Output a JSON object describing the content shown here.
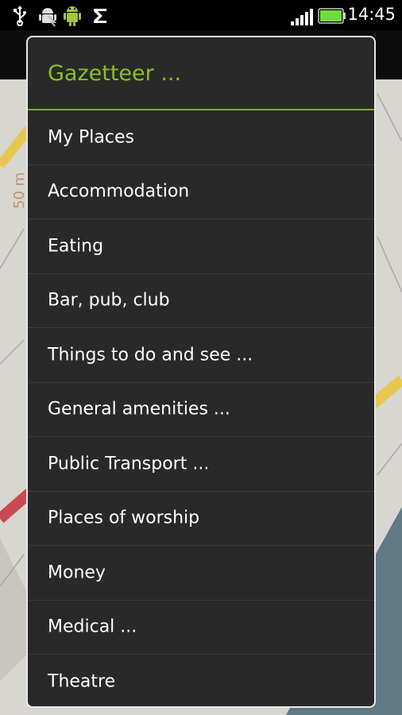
{
  "status_bar": {
    "time": "14:45",
    "icons": [
      "usb-icon",
      "android-debug-icon",
      "android-icon",
      "sync-icon",
      "signal-icon",
      "battery-icon"
    ]
  },
  "map": {
    "scale_label": "50 m"
  },
  "dialog": {
    "title": "Gazetteer ...",
    "items": [
      "My Places",
      "Accommodation",
      "Eating",
      "Bar, pub, club",
      "Things to do and see ...",
      "General amenities ...",
      "Public Transport ...",
      "Places of worship",
      "Money",
      "Medical ...",
      "Theatre"
    ]
  },
  "colors": {
    "title": "#8cbf26",
    "divider": "#7fa92a",
    "dialog_bg": "#292929",
    "battery": "#6fdc3c"
  }
}
